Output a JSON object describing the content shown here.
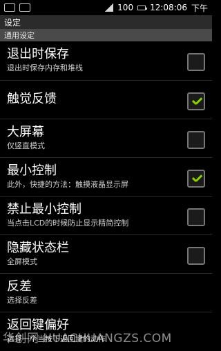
{
  "status": {
    "time": "12:08:06",
    "period": "下午",
    "battery_text": "100"
  },
  "screen": {
    "title": "设定",
    "section": "通用设定"
  },
  "settings": [
    {
      "title": "退出时保存",
      "subtitle": "退出时保存内存和堆栈",
      "checked": false
    },
    {
      "title": "触觉反馈",
      "subtitle": "",
      "checked": true
    },
    {
      "title": "大屏幕",
      "subtitle": "仅竖直模式",
      "checked": false
    },
    {
      "title": "最小控制",
      "subtitle": "此外，快捷的方法：触摸液晶显示屏",
      "checked": true
    },
    {
      "title": "禁止最小控制",
      "subtitle": "当点击LCD的时候防止显示精简控制",
      "checked": false
    },
    {
      "title": "隐藏状态栏",
      "subtitle": "全屏模式",
      "checked": false
    },
    {
      "title": "反差",
      "subtitle": "选择反差",
      "checked": null
    },
    {
      "title": "返回键偏好",
      "subtitle": "选择一个当按下返回键的动作",
      "checked": null
    }
  ],
  "watermark": "华创网 HUACHUANGZS.COM",
  "colors": {
    "check": "#8bd000",
    "section_bg": "#4a4a4a",
    "title_bg": "#2b2b2b"
  }
}
